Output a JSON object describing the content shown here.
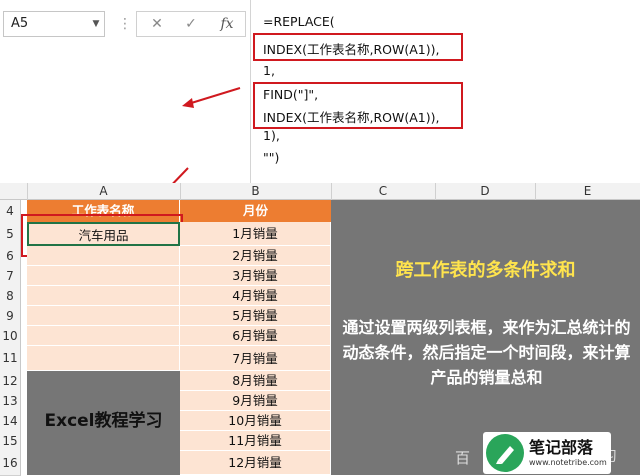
{
  "namebox": {
    "cell": "A5",
    "dropdown_icon": "chevron-down-icon"
  },
  "fx": {
    "cancel": "✕",
    "confirm": "✓",
    "fx_label": "fx"
  },
  "formula": {
    "lines": [
      "=REPLACE(",
      "INDEX(工作表名称,ROW(A1)),",
      "1,",
      "FIND(\"]\",",
      "INDEX(工作表名称,ROW(A1)),",
      "1),",
      "\"\")"
    ]
  },
  "columns": [
    "A",
    "B",
    "C",
    "D",
    "E"
  ],
  "rows": [
    "4",
    "5",
    "6",
    "7",
    "8",
    "9",
    "10",
    "11",
    "12",
    "13",
    "14",
    "15",
    "16"
  ],
  "table": {
    "header_a": "工作表名称",
    "header_b": "月份",
    "a5": "汽车用品",
    "months": [
      "1月销量",
      "2月销量",
      "3月销量",
      "4月销量",
      "5月销量",
      "6月销量",
      "7月销量",
      "8月销量",
      "9月销量",
      "10月销量",
      "11月销量",
      "12月销量"
    ]
  },
  "panel": {
    "title": "跨工作表的多条件求和",
    "description": "通过设置两级列表框，来作为汇总统计的动态条件，然后指定一个时间段，来计算产品的销量总和",
    "brand": "Excel教程学习"
  },
  "watermark": {
    "name": "笔记部落",
    "url": "www.notetribe.com",
    "partial": "百",
    "partial2": "学习"
  },
  "colors": {
    "header_orange": "#ed7d31",
    "peach": "#fde4d3",
    "panel_gray": "#767676",
    "title_yellow": "#ffe44d",
    "highlight_red": "#d0191f"
  }
}
